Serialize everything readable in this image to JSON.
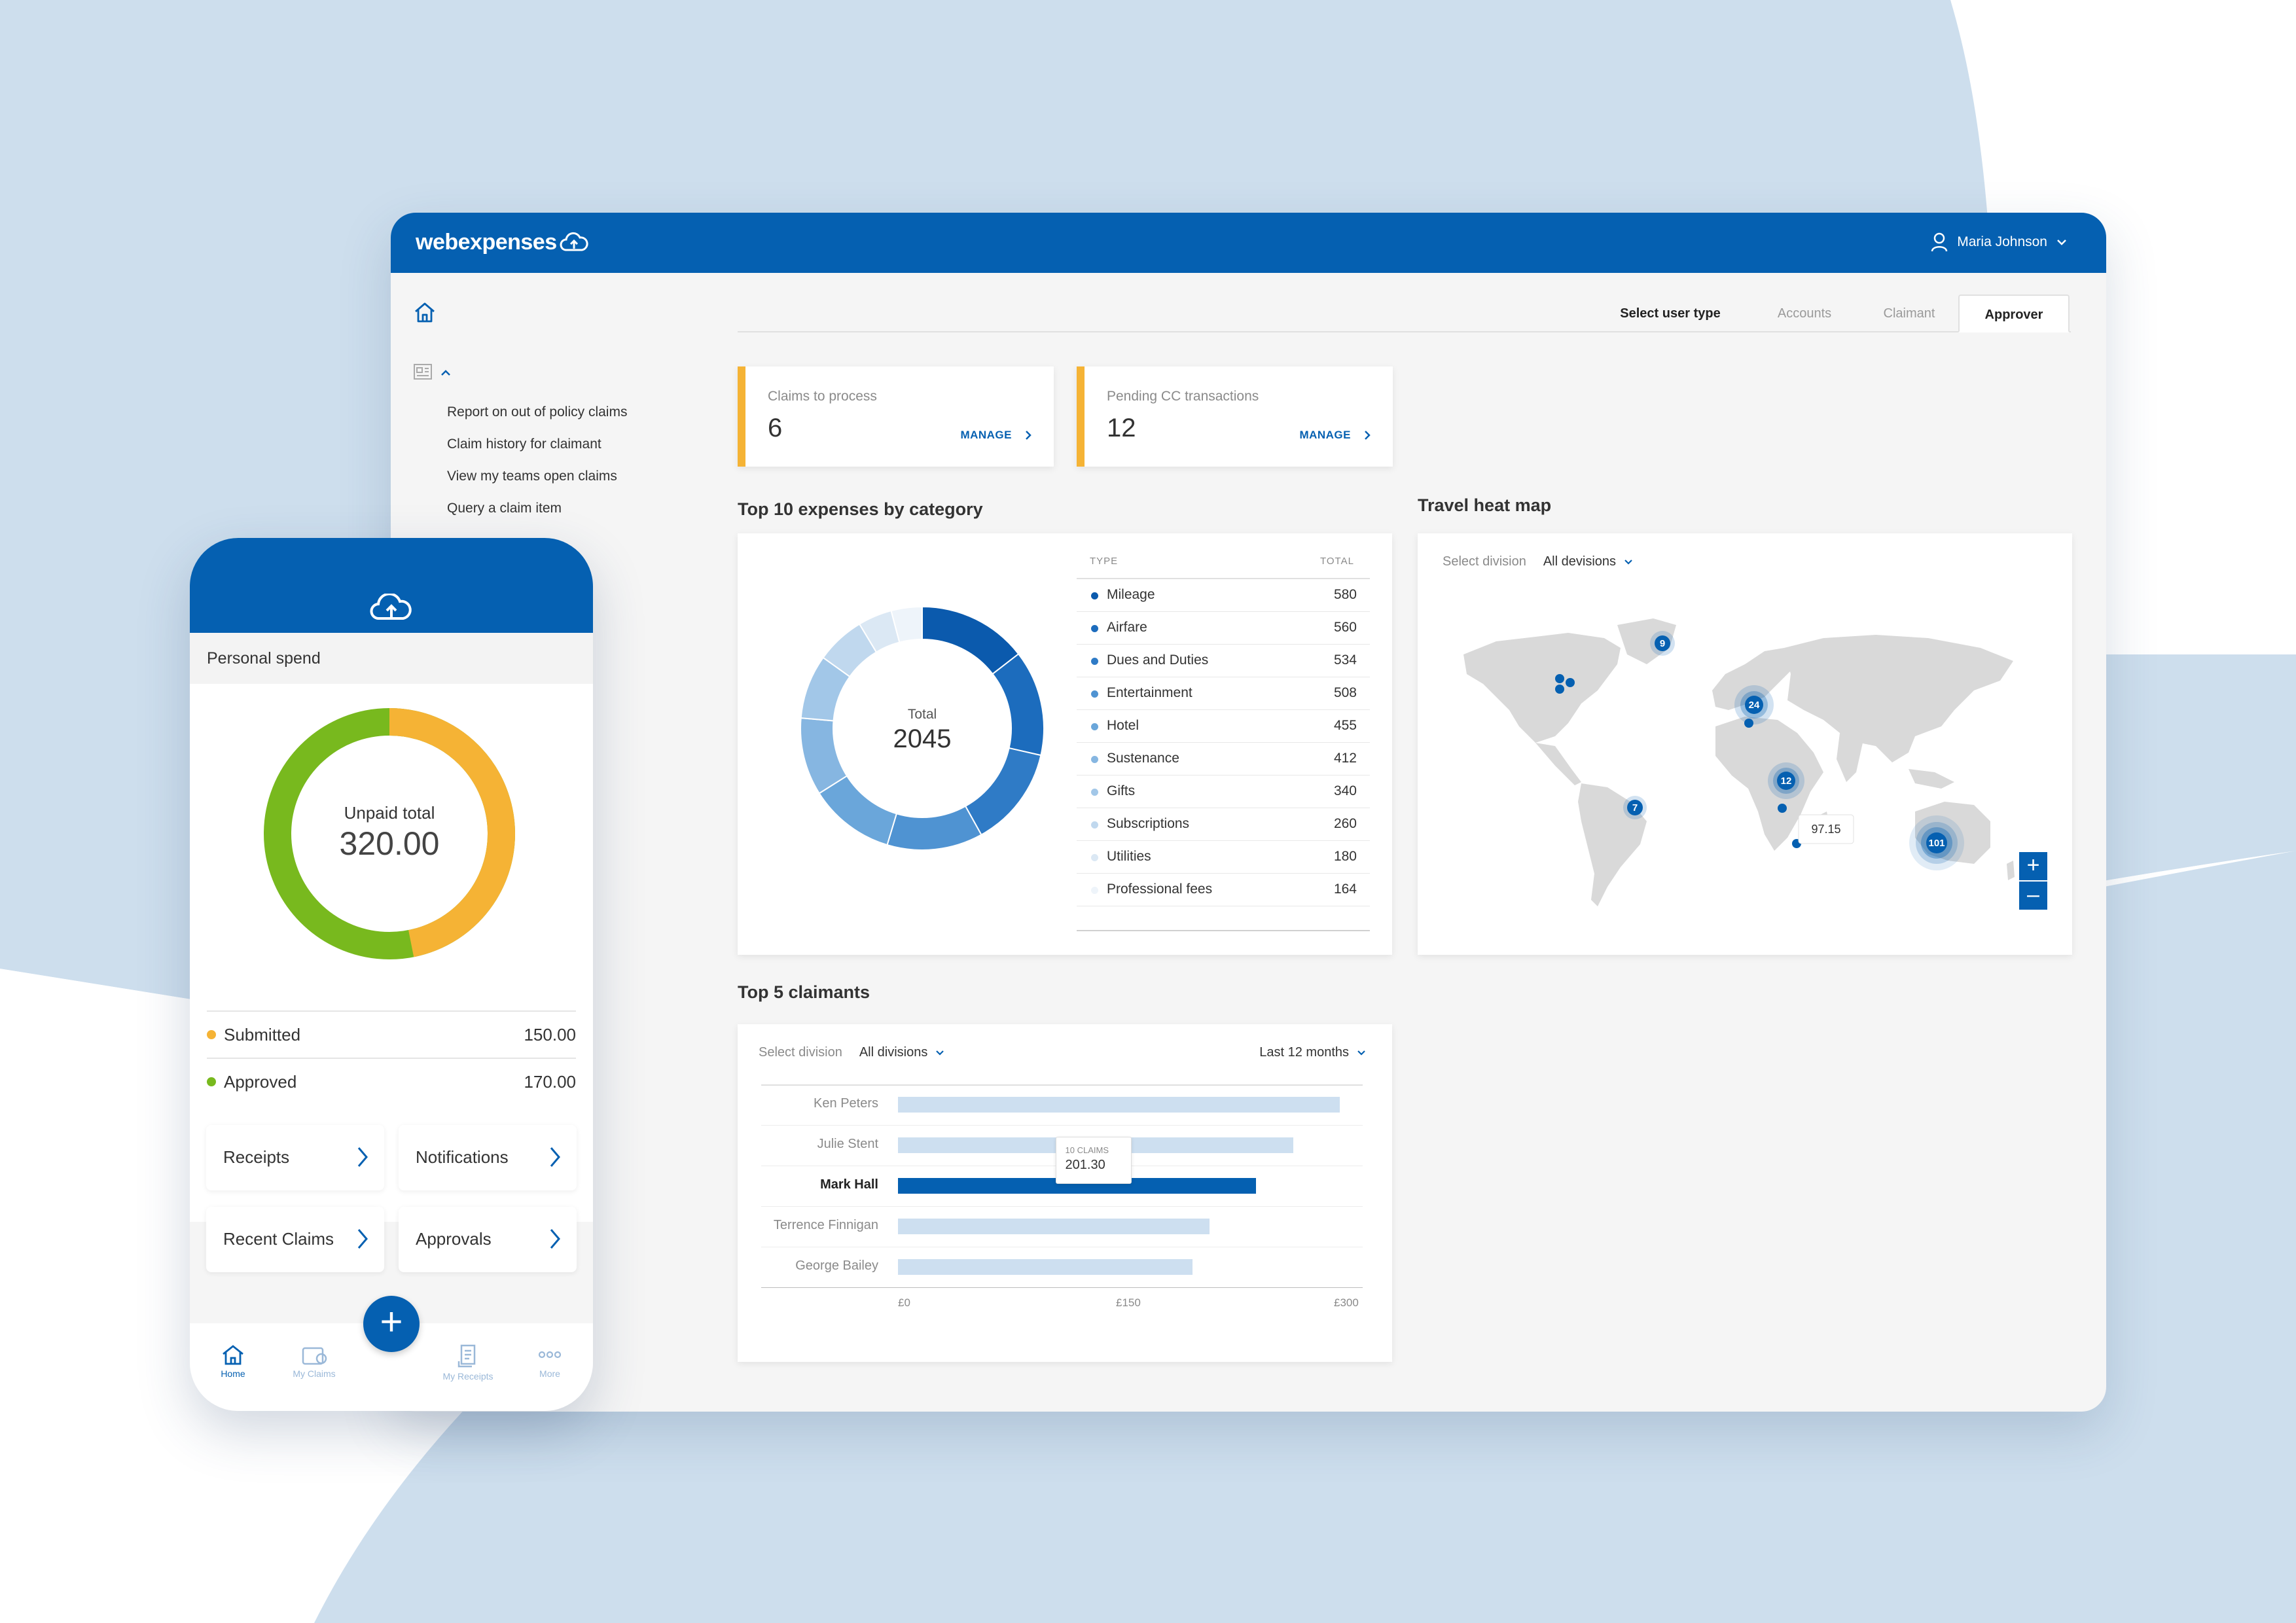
{
  "brand": {
    "logo_text": "webexpenses",
    "primary": "#0560b1",
    "accent": "#f5b335"
  },
  "header": {
    "user_name": "Maria Johnson",
    "user_icon": "user-icon",
    "dropdown_icon": "chevron-down-icon"
  },
  "sidebar": {
    "home_icon": "home-icon",
    "reports_icon": "report-icon",
    "items": [
      {
        "label": "Report on out of policy claims"
      },
      {
        "label": "Claim history for claimant"
      },
      {
        "label": "View my teams open claims"
      },
      {
        "label": "Query a claim item"
      }
    ]
  },
  "user_type": {
    "label": "Select user type",
    "tabs": [
      {
        "label": "Accounts"
      },
      {
        "label": "Claimant"
      },
      {
        "label": "Approver",
        "active": true
      }
    ]
  },
  "stats": [
    {
      "label": "Claims to process",
      "value": "6",
      "action": "MANAGE"
    },
    {
      "label": "Pending CC transactions",
      "value": "12",
      "action": "MANAGE"
    }
  ],
  "expenses": {
    "title": "Top 10 expenses by category",
    "col_type": "TYPE",
    "col_total": "TOTAL",
    "donut_label": "Total",
    "donut_total": "2045"
  },
  "chart_data": [
    {
      "type": "pie",
      "title": "Top 10 expenses by category",
      "categories": [
        "Mileage",
        "Airfare",
        "Dues and Duties",
        "Entertainment",
        "Hotel",
        "Sustenance",
        "Gifts",
        "Subscriptions",
        "Utilities",
        "Professional fees"
      ],
      "values": [
        580,
        560,
        534,
        508,
        455,
        412,
        340,
        260,
        180,
        164
      ],
      "colors": [
        "#0b5aad",
        "#1c6cbd",
        "#2f7bc6",
        "#4f93d2",
        "#6aa6da",
        "#86b6e1",
        "#a2c7e8",
        "#c0d8ee",
        "#dbe8f4",
        "#eef4fa"
      ],
      "center_label": "Total",
      "center_value": "2045"
    },
    {
      "type": "bar",
      "title": "Top 5 claimants",
      "orientation": "horizontal",
      "categories": [
        "Ken Peters",
        "Julie Stent",
        "Mark Hall",
        "Terrence Finnigan",
        "George Bailey"
      ],
      "values": [
        285,
        255,
        231,
        201.3,
        190
      ],
      "highlight": "Mark Hall",
      "xlim": [
        0,
        300
      ],
      "x_ticks": [
        "£0",
        "£150",
        "£300"
      ],
      "tooltip": {
        "label": "10 CLAIMS",
        "value": "201.30"
      }
    }
  ],
  "heatmap": {
    "title": "Travel heat map",
    "select_label": "Select division",
    "division": "All devisions",
    "clusters": [
      {
        "count": "9"
      },
      {
        "count": "24"
      },
      {
        "count": "12"
      },
      {
        "count": "7"
      },
      {
        "count": "101"
      }
    ],
    "tooltip": "97.15",
    "zoom_in": "+",
    "zoom_out": "–"
  },
  "claimants": {
    "title": "Top 5 claimants",
    "select_label": "Select division",
    "division": "All divisions",
    "period": "Last 12 months"
  },
  "phone": {
    "section": "Personal spend",
    "donut_label": "Unpaid total",
    "donut_value": "320.00",
    "rows": [
      {
        "label": "Submitted",
        "amount": "150.00",
        "color": "#f5b335"
      },
      {
        "label": "Approved",
        "amount": "170.00",
        "color": "#78b91e"
      }
    ],
    "tiles": [
      {
        "label": "Receipts"
      },
      {
        "label": "Notifications"
      },
      {
        "label": "Recent Claims"
      },
      {
        "label": "Approvals"
      }
    ],
    "nav": [
      {
        "label": "Home"
      },
      {
        "label": "My Claims"
      },
      {
        "label": "My Receipts"
      },
      {
        "label": "More"
      }
    ],
    "fab": "+"
  }
}
